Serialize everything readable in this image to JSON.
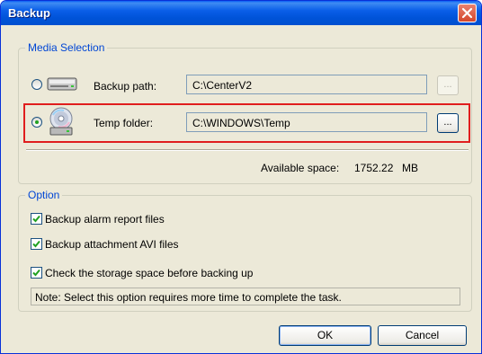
{
  "window": {
    "title": "Backup"
  },
  "media": {
    "group_title": "Media Selection",
    "backup_path": {
      "label": "Backup path:",
      "value": "C:\\CenterV2",
      "browse": "..."
    },
    "temp_folder": {
      "label": "Temp folder:",
      "value": "C:\\WINDOWS\\Temp",
      "browse": "..."
    },
    "available_label": "Available space:",
    "available_value": "1752.22",
    "available_unit": "MB"
  },
  "option": {
    "group_title": "Option",
    "checkboxes": [
      {
        "label": "Backup alarm report files",
        "checked": true
      },
      {
        "label": "Backup attachment AVI files",
        "checked": true
      },
      {
        "label": "Check the storage space before backing up",
        "checked": true
      }
    ],
    "note": "Note: Select this option requires more time to complete the task."
  },
  "buttons": {
    "ok": "OK",
    "cancel": "Cancel"
  },
  "colors": {
    "title_bar": "#0a5ee8",
    "highlight": "#e01e1e",
    "group_title": "#0046d5"
  },
  "icons": {
    "backup_drive": "hard-drive-icon",
    "temp_folder": "disc-drive-icon",
    "close": "close-icon"
  }
}
